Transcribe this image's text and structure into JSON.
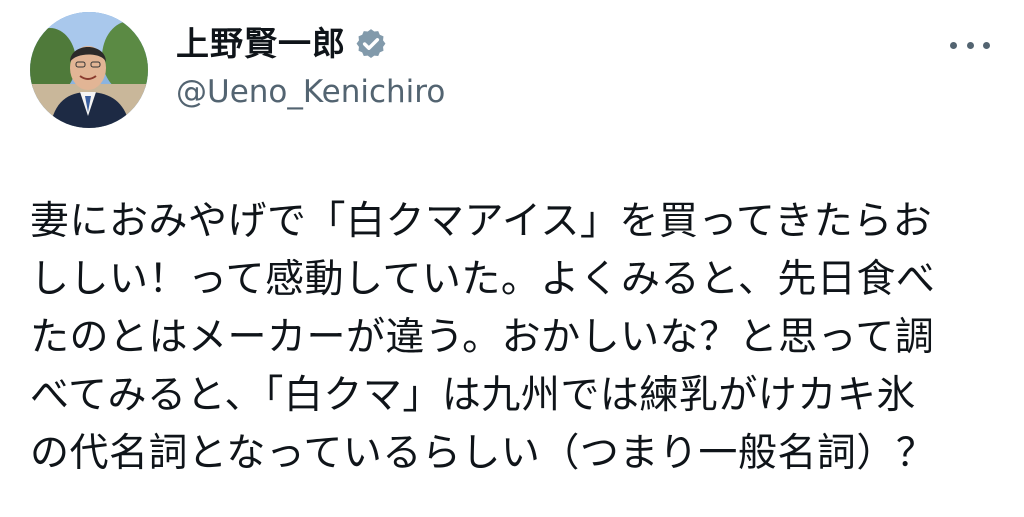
{
  "author": {
    "display_name": "上野賢一郎",
    "handle": "@Ueno_Kenichiro",
    "avatar": "avatar-photo",
    "verified_icon": "verified-badge-icon",
    "verified_color": "#829aab"
  },
  "menu": {
    "more_icon": "more-options-icon"
  },
  "tweet": {
    "lines": [
      "妻におみやげで「白クマアイス」を買ってきたらお",
      "ししい！って感動していた。よくみると、先日食べ",
      "たのとはメーカーが違う。おかしいな？と思って調",
      "べてみると、「白クマ」は九州では練乳がけカキ氷",
      "の代名詞となっているらしい（つまり一般名詞）？"
    ]
  },
  "colors": {
    "text": "#0f1419",
    "secondary": "#536471",
    "background": "#ffffff"
  }
}
